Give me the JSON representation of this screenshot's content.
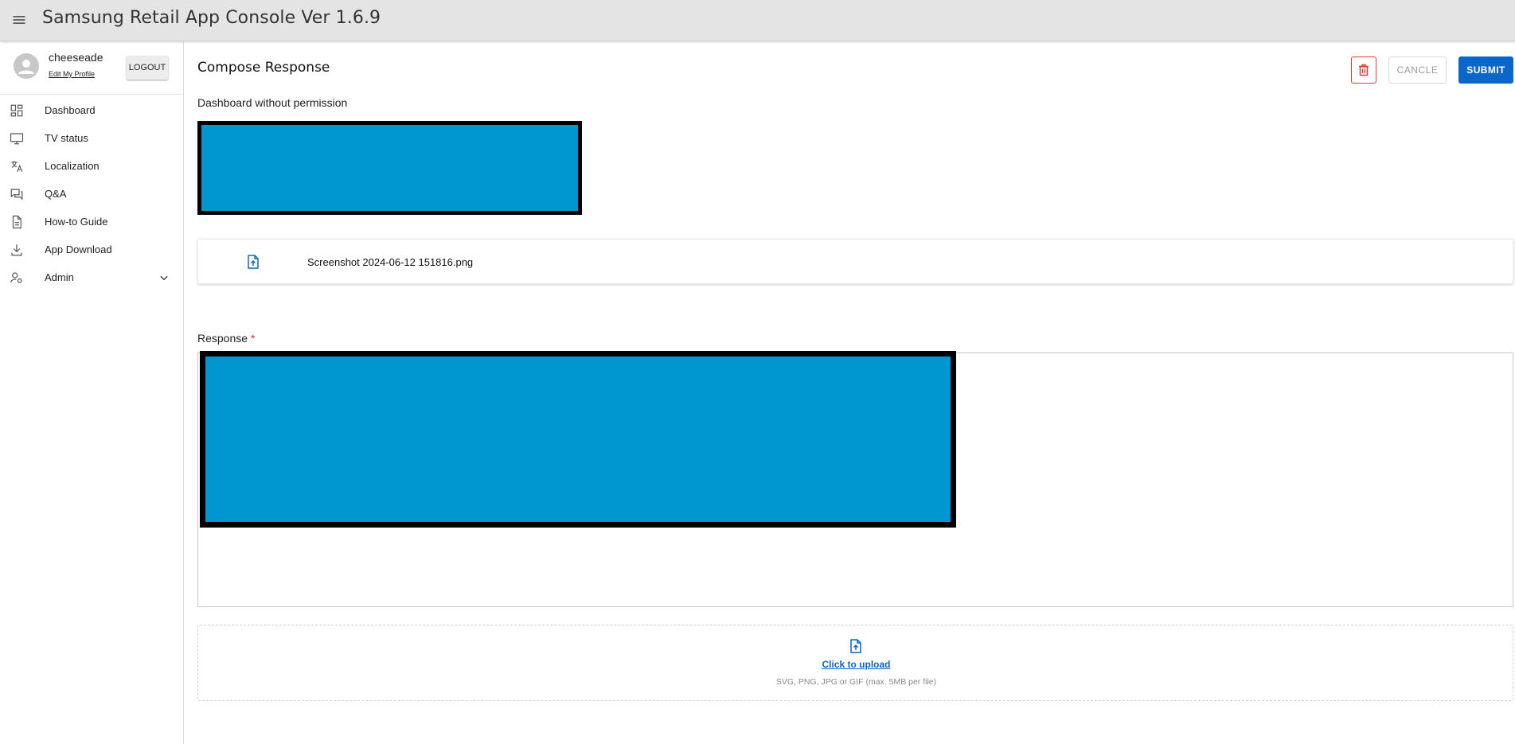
{
  "app": {
    "title": "Samsung Retail App Console Ver 1.6.9"
  },
  "user": {
    "name": "cheeseade",
    "edit_profile_label": "Edit My Profile",
    "logout_label": "LOGOUT"
  },
  "sidebar": {
    "items": [
      {
        "label": "Dashboard",
        "icon": "dashboard-icon"
      },
      {
        "label": "TV status",
        "icon": "monitor-icon"
      },
      {
        "label": "Localization",
        "icon": "translate-icon"
      },
      {
        "label": "Q&A",
        "icon": "forum-icon"
      },
      {
        "label": "How-to Guide",
        "icon": "document-icon"
      },
      {
        "label": "App Download",
        "icon": "download-icon"
      },
      {
        "label": "Admin",
        "icon": "admin-icon",
        "expandable": true
      }
    ]
  },
  "main": {
    "heading": "Compose Response",
    "actions": {
      "cancel_label": "CANCLE",
      "submit_label": "SUBMIT"
    },
    "question_title": "Dashboard without permission",
    "attachment": {
      "file_name": "Screenshot 2024-06-12 151816.png"
    },
    "response": {
      "label": "Response",
      "required_mark": "*"
    },
    "upload": {
      "link_text": "Click to upload",
      "hint": "SVG, PNG, JPG or GIF (max. 5MB per file)"
    }
  },
  "colors": {
    "accent": "#0a66c8",
    "danger": "#e53935",
    "redaction": "#0096cf",
    "topbar": "#e4e4e4"
  }
}
